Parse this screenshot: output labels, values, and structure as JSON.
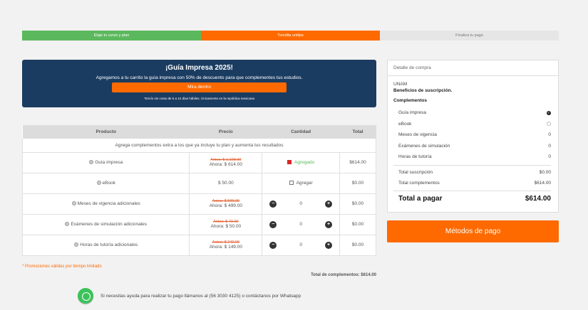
{
  "steps": [
    {
      "label": "Elige tu curso y plan"
    },
    {
      "label": "Tiendita unitips"
    },
    {
      "label": "Finaliza tu pago"
    }
  ],
  "banner": {
    "title": "¡Guía Impresa 2025!",
    "subtitle": "Agregamos a tu carrito la guía impresa con 50% de descuento para que complementes tus estudios.",
    "button": "Mira dentro",
    "note": "*Envío sin costo de 5 a 12 días hábiles. Únicamente en la república mexicana"
  },
  "table": {
    "headers": [
      "Producto",
      "Precio",
      "Cantidad",
      "Total"
    ],
    "intro": "Agrega complementos extra a los que ya incluye tu plan y aumenta tus resultados",
    "rows": [
      {
        "product": "Guía impresa",
        "old_price": "Antes: $ 1,228.00",
        "price": "Ahora: $ 614.00",
        "qty_label": "Agregado",
        "total": "$614.00"
      },
      {
        "product": "eBook",
        "price": "$ 50.00",
        "qty_label": "Agregar",
        "total": "$0.00"
      },
      {
        "product": "Meses de vigencia adicionales",
        "old_price": "Antes: $ 599.00",
        "price": "Ahora: $ 499.00",
        "qty": "0",
        "total": "$0.00"
      },
      {
        "product": "Exámenes de simulación adicionales",
        "old_price": "Antes: $ 70.00",
        "price": "Ahora: $ 50.00",
        "qty": "0",
        "total": "$0.00"
      },
      {
        "product": "Horas de tutoría adicionales",
        "old_price": "Antes: $ 249.00",
        "price": "Ahora: $ 149.00",
        "qty": "0",
        "total": "$0.00"
      }
    ]
  },
  "promo_note": "* Promociones válidas por tiempo limitado",
  "total_complements": "Total de complementos: $614.00",
  "help_text": "Si necesitas ayuda para realizar tu pago llámanos al (56 3030 4125) o contáctanos por Whatsapp",
  "summary": {
    "header": "Detalle de compra",
    "university": "UNAM",
    "benefits": "Beneficios de suscripción.",
    "complements_title": "Complementos",
    "items": [
      {
        "label": "Guía impresa",
        "value": "✓"
      },
      {
        "label": "eBook",
        "value": ""
      },
      {
        "label": "Meses de vigencia",
        "value": "0"
      },
      {
        "label": "Exámenes de simulación",
        "value": "0"
      },
      {
        "label": "Horas de tutoría",
        "value": "0"
      }
    ],
    "total_subscription_label": "Total suscripción",
    "total_subscription": "$0.00",
    "total_complements_label": "Total complementos",
    "total_complements": "$614.00",
    "grand_label": "Total a pagar",
    "grand_total": "$614.00"
  },
  "pay_button": "Métodos de pago",
  "colors": {
    "accent": "#ff6a00",
    "success": "#5cb85c",
    "banner": "#1b3c61"
  }
}
